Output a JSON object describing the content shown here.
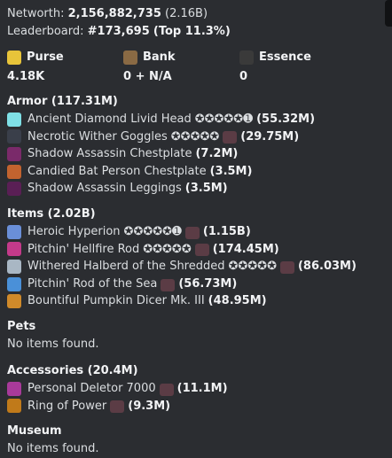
{
  "summary": {
    "networth_label": "Networth:",
    "networth_value": "2,156,882,735",
    "networth_short": "(2.16B)",
    "leaderboard_label": "Leaderboard:",
    "leaderboard_value": "#173,695",
    "leaderboard_pct": "(Top 11.3%)"
  },
  "balances": [
    {
      "label": "Purse",
      "value": "4.18K",
      "icon": "gold-ingot-icon",
      "color": "#e8c43a"
    },
    {
      "label": "Bank",
      "value": "0 + N/A",
      "icon": "chest-icon",
      "color": "#8a6a44"
    },
    {
      "label": "Essence",
      "value": "0",
      "icon": "essence-icon",
      "color": "#3a3a3a"
    }
  ],
  "sections": {
    "armor": {
      "title": "Armor (117.31M)",
      "items": [
        {
          "name": "Ancient Diamond Livid Head",
          "stars": "✪✪✪✪✪➊",
          "price": "(55.32M)",
          "color": "#7fe0e6",
          "anvil": false
        },
        {
          "name": "Necrotic Wither Goggles",
          "stars": "✪✪✪✪✪",
          "price": "(29.75M)",
          "color": "#3a3f4a",
          "anvil": true
        },
        {
          "name": "Shadow Assassin Chestplate",
          "stars": "",
          "price": "(7.2M)",
          "color": "#7a2a6a",
          "anvil": false
        },
        {
          "name": "Candied Bat Person Chestplate",
          "stars": "",
          "price": "(3.5M)",
          "color": "#c2632f",
          "anvil": false
        },
        {
          "name": "Shadow Assassin Leggings",
          "stars": "",
          "price": "(3.5M)",
          "color": "#5a1f55",
          "anvil": false
        }
      ]
    },
    "items": {
      "title": "Items (2.02B)",
      "items": [
        {
          "name": "Heroic Hyperion",
          "stars": "✪✪✪✪✪➊",
          "price": "(1.15B)",
          "color": "#6a8fd8",
          "anvil": true
        },
        {
          "name": "Pitchin' Hellfire Rod",
          "stars": "✪✪✪✪✪",
          "price": "(174.45M)",
          "color": "#c43a8a",
          "anvil": true
        },
        {
          "name": "Withered Halberd of the Shredded",
          "stars": "✪✪✪✪✪",
          "price": "(86.03M)",
          "color": "#a9b7c4",
          "anvil": true
        },
        {
          "name": "Pitchin' Rod of the Sea",
          "stars": "",
          "price": "(56.73M)",
          "color": "#4a90d8",
          "anvil": true
        },
        {
          "name": "Bountiful Pumpkin Dicer Mk. III",
          "stars": "",
          "price": "(48.95M)",
          "color": "#d08a2a",
          "anvil": false
        }
      ]
    },
    "pets": {
      "title": "Pets",
      "empty": "No items found."
    },
    "accessories": {
      "title": "Accessories (20.4M)",
      "items": [
        {
          "name": "Personal Deletor 7000",
          "stars": "",
          "price": "(11.1M)",
          "color": "#a83a9a",
          "anvil": true
        },
        {
          "name": "Ring of Power",
          "stars": "",
          "price": "(9.3M)",
          "color": "#c07a1a",
          "anvil": true
        }
      ]
    },
    "museum": {
      "title": "Museum",
      "empty": "No items found."
    }
  }
}
